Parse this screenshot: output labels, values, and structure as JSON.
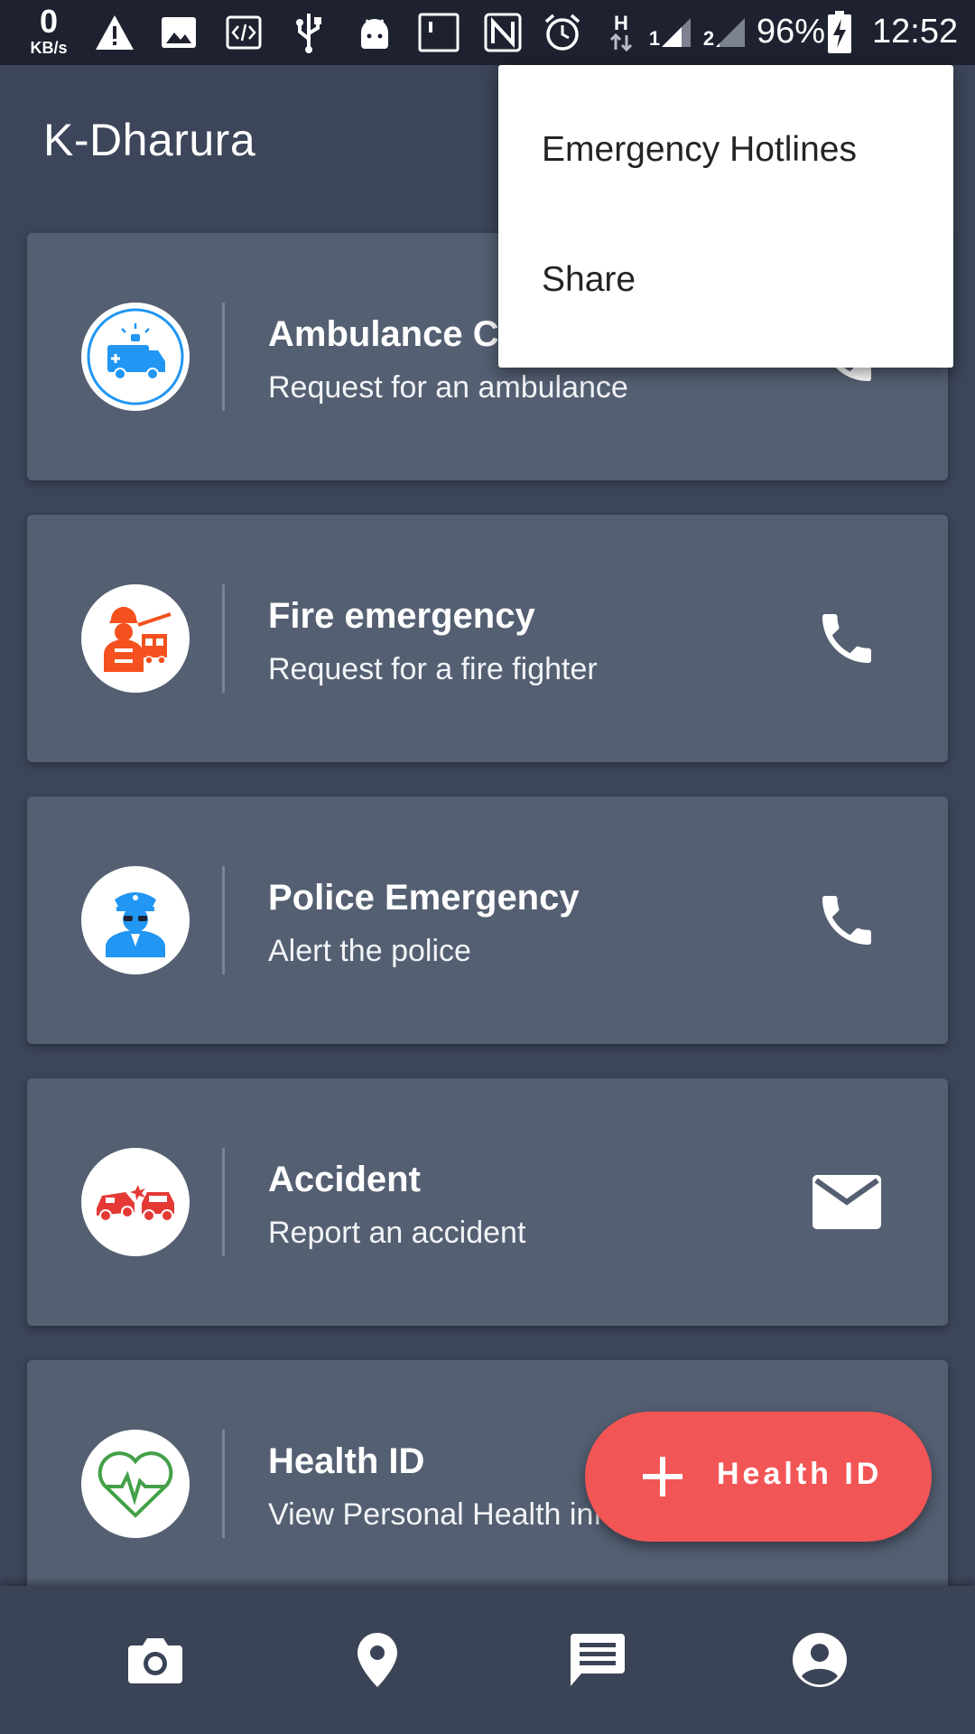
{
  "status_bar": {
    "speed_value": "0",
    "speed_unit": "KB/s",
    "network_type": "H",
    "sim1_label": "1",
    "sim2_label": "2",
    "battery": "96%",
    "time": "12:52",
    "icons": [
      "warning-icon",
      "image-icon",
      "code-icon",
      "usb-icon",
      "android-icon",
      "screen-icon",
      "nfc-icon",
      "alarm-icon",
      "signal-icon",
      "battery-charging-icon"
    ]
  },
  "app": {
    "title": "K-Dharura"
  },
  "menu": {
    "items": [
      {
        "label": "Emergency Hotlines"
      },
      {
        "label": "Share"
      }
    ]
  },
  "cards": [
    {
      "title": "Ambulance Call",
      "subtitle": "Request for an ambulance",
      "icon": "ambulance-icon",
      "action_icon": "phone-icon",
      "accent": "#2196f3"
    },
    {
      "title": "Fire emergency",
      "subtitle": "Request for a fire fighter",
      "icon": "firefighter-icon",
      "action_icon": "phone-icon",
      "accent": "#f4511e"
    },
    {
      "title": "Police Emergency",
      "subtitle": "Alert the police",
      "icon": "police-officer-icon",
      "action_icon": "phone-icon",
      "accent": "#2196f3"
    },
    {
      "title": "Accident",
      "subtitle": "Report an accident",
      "icon": "car-accident-icon",
      "action_icon": "email-icon",
      "accent": "#e53935"
    },
    {
      "title": "Health ID",
      "subtitle": "View Personal Health info",
      "icon": "heartbeat-icon",
      "action_icon": "",
      "accent": "#43a047"
    }
  ],
  "fab": {
    "label": "Health ID",
    "icon": "plus-icon",
    "color": "#f25555"
  },
  "bottom_nav": {
    "items": [
      "camera-icon",
      "location-pin-icon",
      "message-icon",
      "account-icon"
    ]
  },
  "colors": {
    "background": "#3c4559",
    "card": "#545f72",
    "status_bar": "#1e2230"
  }
}
